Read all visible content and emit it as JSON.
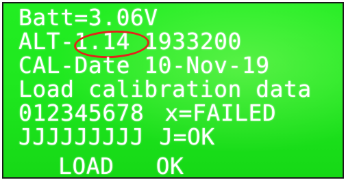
{
  "display": {
    "line1": "Batt=3.06V",
    "line2_prefix": "ALT-",
    "line2_value": "1.14",
    "line2_suffix": "1933200",
    "line3": "CAL-Date 10-Nov-19",
    "line4": "Load calibration data",
    "line5_digits": "012345678",
    "line5_legend": "x=FAILED",
    "line6_checks": "JJJJJJJJJ",
    "line6_legend": "J=OK",
    "buttons": {
      "load_label": "LOAD",
      "ok_label": "OK"
    }
  },
  "colors": {
    "screen_background": "#1fe81f",
    "text": "#ffffff",
    "highlight_circle": "#e2231a"
  }
}
